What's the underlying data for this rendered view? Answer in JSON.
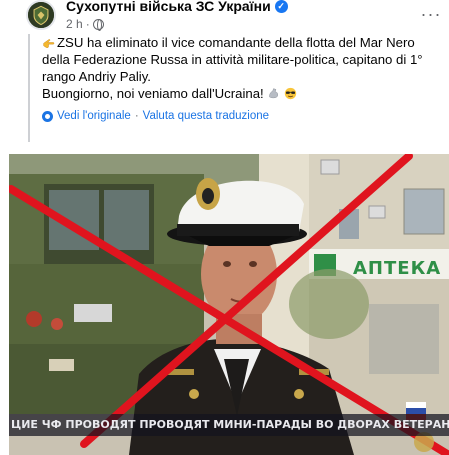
{
  "header": {
    "page_name": "Сухопутні війська ЗС України",
    "time": "2 h",
    "dot": "·"
  },
  "post": {
    "line1": "ZSU ha eliminato il vice comandante della flotta del Mar Nero della Federazione Russa in attività militare-politica, capitano di 1° rango Andriy Paliy.",
    "line2": "Buongiorno, noi veniamo dall'Ucraina!"
  },
  "translation_bar": {
    "see_original": "Vedi l'originale",
    "separator": "·",
    "rate_translation": "Valuta questa traduzione"
  },
  "image": {
    "sign_text": "АПТЕКА",
    "ticker_text": "ЦИЕ ЧФ ПРОВОДЯТ ПРОВОДЯТ МИНИ-ПАРАДЫ ВО ДВОРАХ ВЕТЕРАНОВ",
    "cross_color": "#e0141e"
  },
  "icons": {
    "verified": "verified-badge-icon",
    "more": "more-options-icon",
    "globe": "globe-icon",
    "gear": "gear-icon",
    "hand": "pointing-hand-icon"
  }
}
